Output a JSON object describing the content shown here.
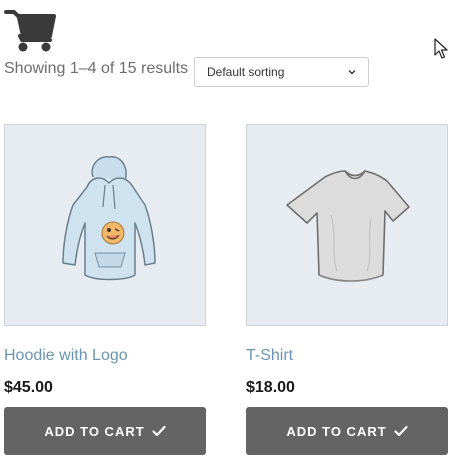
{
  "header": {
    "cart_icon": "shopping-cart-icon"
  },
  "shop": {
    "result_count": "Showing 1–4 of 15 results",
    "ordering_selected": "Default sorting"
  },
  "products": [
    {
      "title": "Hoodie with Logo",
      "price": "$45.00",
      "button_label": "ADD TO CART",
      "image_icon": "hoodie-image"
    },
    {
      "title": "T-Shirt",
      "price": "$18.00",
      "button_label": "ADD TO CART",
      "image_icon": "t-shirt-image"
    }
  ],
  "colors": {
    "link": "#6b95b0",
    "button_bg": "#646464",
    "thumb_bg": "#e7ecf2"
  }
}
